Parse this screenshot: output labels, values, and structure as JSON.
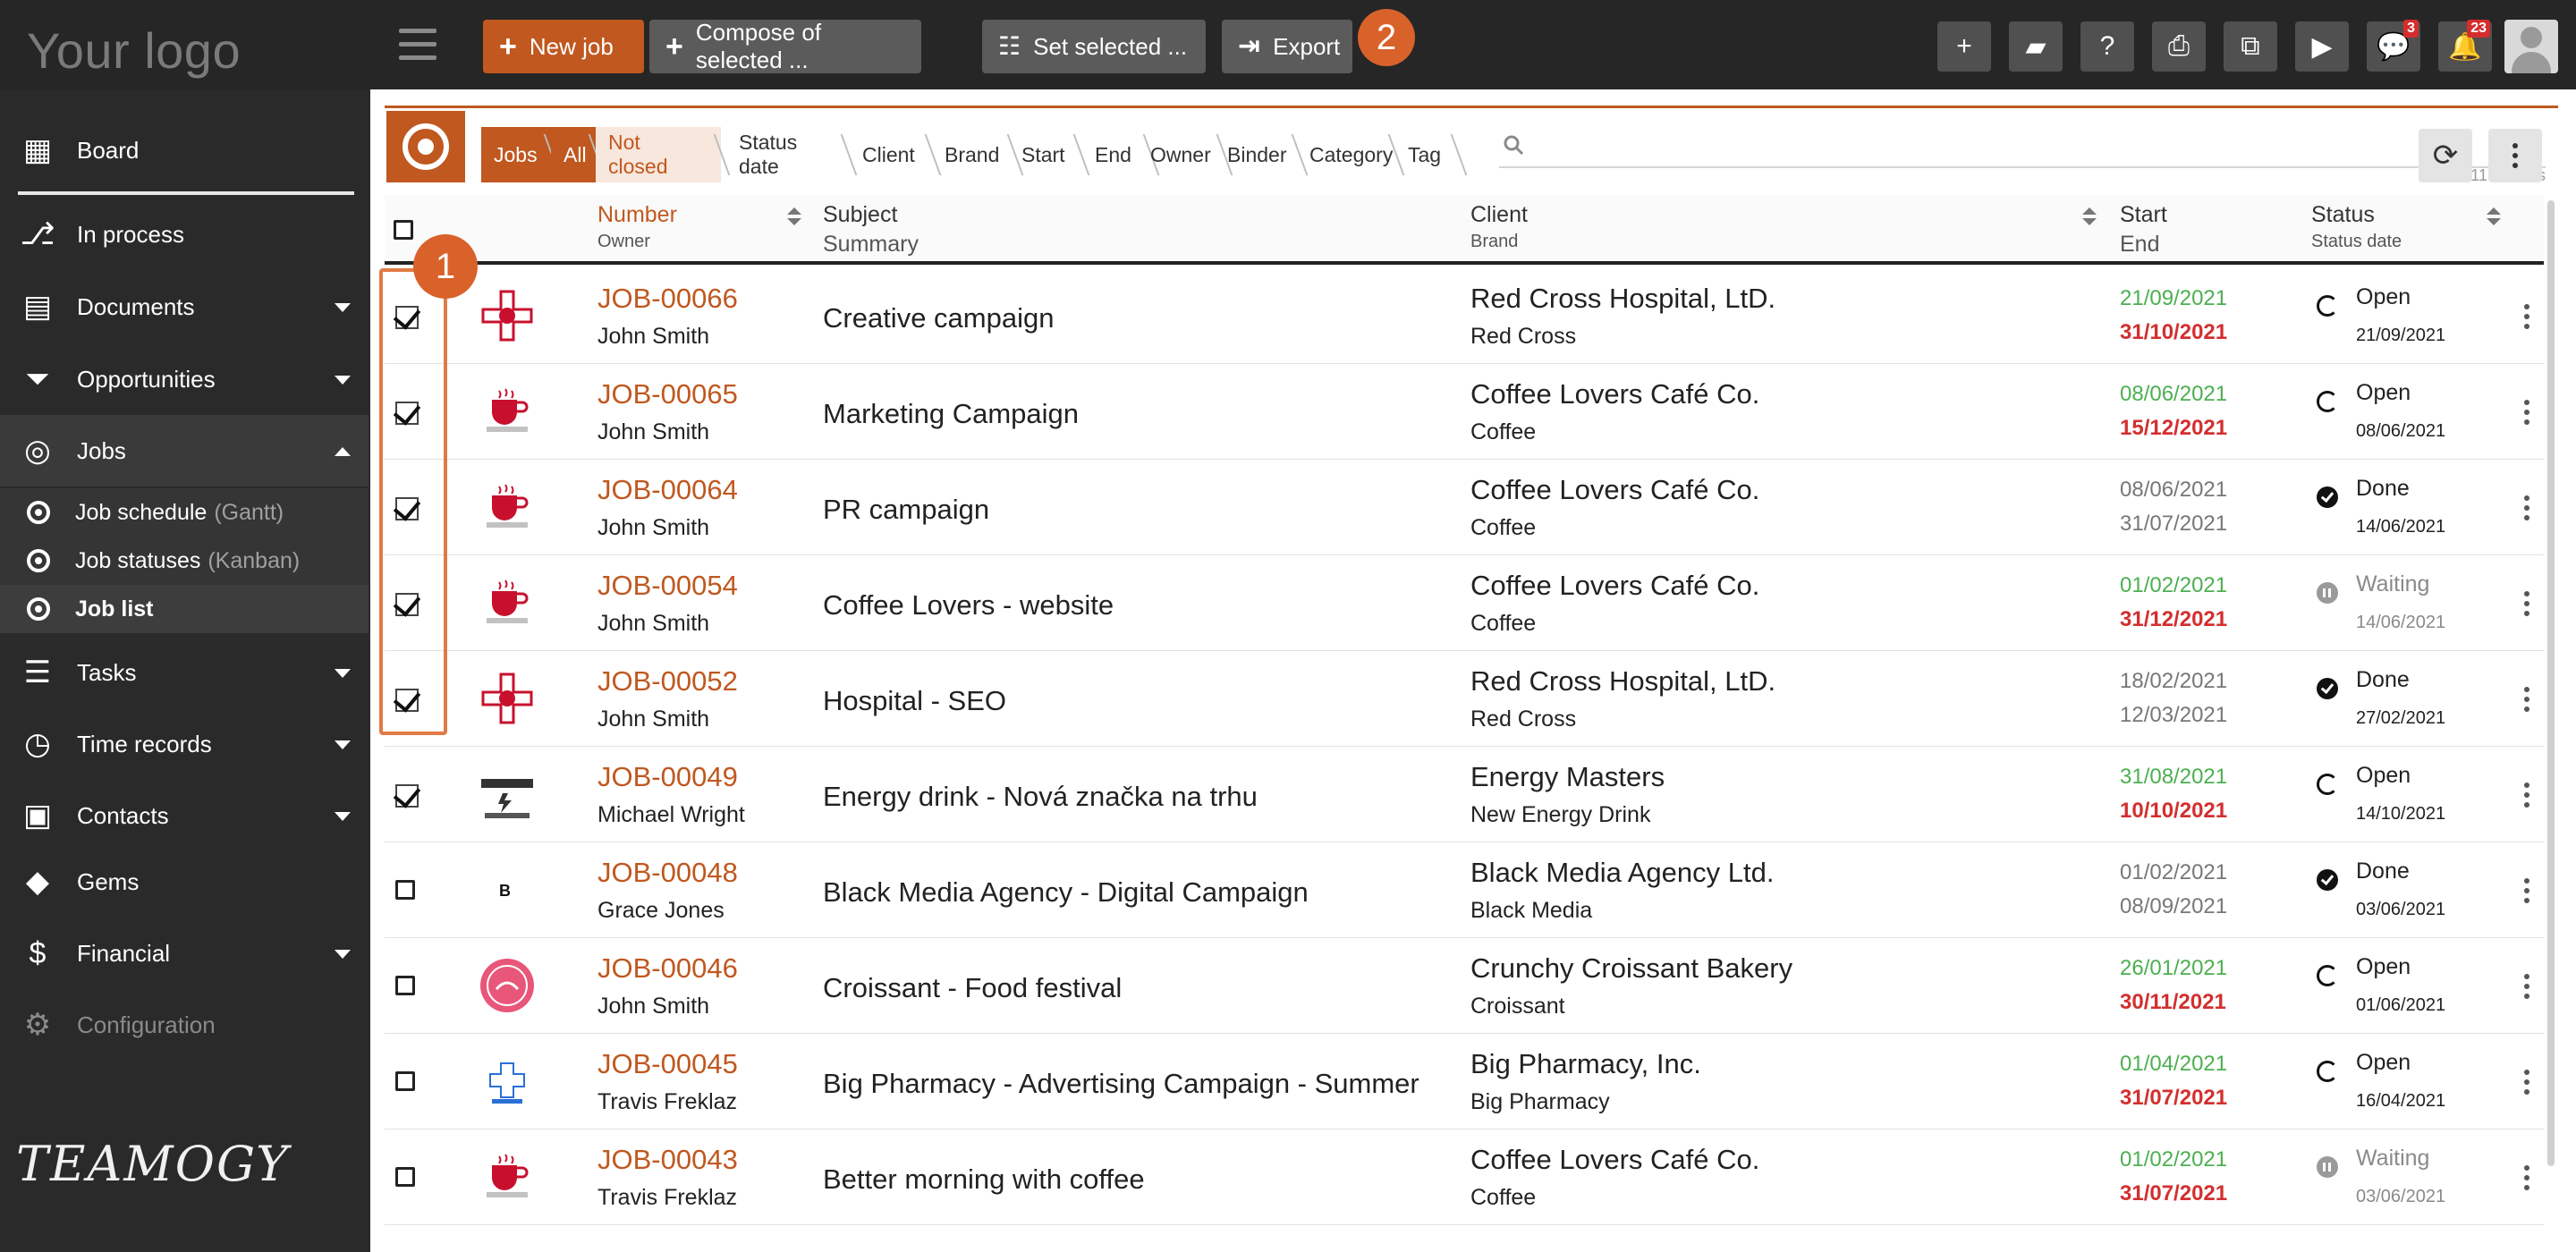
{
  "app": {
    "logo_text": "Your logo",
    "brand": "TEAMOGY"
  },
  "toolbar": {
    "new_job": "New job",
    "compose": "Compose of selected ...",
    "set_selected": "Set selected ...",
    "export": "Export",
    "callout_1": "1",
    "callout_2": "2",
    "chat_count": "3",
    "notif_count": "23"
  },
  "sidebar": {
    "items": [
      {
        "label": "Board",
        "icon": "grid-icon"
      },
      {
        "label": "In process",
        "icon": "flow-icon"
      },
      {
        "label": "Documents",
        "icon": "document-icon"
      },
      {
        "label": "Opportunities",
        "icon": "funnel-icon"
      },
      {
        "label": "Jobs",
        "icon": "target-icon"
      },
      {
        "label": "Tasks",
        "icon": "tasks-icon"
      },
      {
        "label": "Time records",
        "icon": "clock-icon"
      },
      {
        "label": "Contacts",
        "icon": "contact-icon"
      },
      {
        "label": "Gems",
        "icon": "gem-icon"
      },
      {
        "label": "Financial",
        "icon": "dollar-icon"
      },
      {
        "label": "Configuration",
        "icon": "gear-icon"
      }
    ],
    "jobs_sub": [
      {
        "label": "Job schedule",
        "muted": "(Gantt)"
      },
      {
        "label": "Job statuses",
        "muted": "(Kanban)"
      },
      {
        "label": "Job list",
        "muted": ""
      }
    ]
  },
  "filters": {
    "crumbs": [
      "Jobs",
      "All",
      "Not closed",
      "Status date",
      "Client",
      "Brand",
      "Start",
      "End",
      "Owner",
      "Binder",
      "Category",
      "Tag"
    ],
    "records": "11/11 records"
  },
  "table": {
    "headers": {
      "number": "Number",
      "owner": "Owner",
      "subject": "Subject",
      "summary": "Summary",
      "client": "Client",
      "brand": "Brand",
      "start": "Start",
      "end": "End",
      "status": "Status",
      "status_date": "Status date"
    },
    "rows": [
      {
        "no": "JOB-00066",
        "owner": "John Smith",
        "subject": "Creative campaign",
        "client": "Red Cross Hospital, LtD.",
        "brand": "Red Cross",
        "start": "21/09/2021",
        "end": "31/10/2021",
        "startc": "green",
        "endc": "red",
        "status": "Open",
        "sdate": "21/09/2021",
        "sicon": "open",
        "checked": true,
        "logo": "redcross"
      },
      {
        "no": "JOB-00065",
        "owner": "John Smith",
        "subject": "Marketing Campaign",
        "client": "Coffee Lovers Café Co.",
        "brand": "Coffee",
        "start": "08/06/2021",
        "end": "15/12/2021",
        "startc": "green",
        "endc": "red",
        "status": "Open",
        "sdate": "08/06/2021",
        "sicon": "open",
        "checked": true,
        "logo": "coffee"
      },
      {
        "no": "JOB-00064",
        "owner": "John Smith",
        "subject": "PR campaign",
        "client": "Coffee Lovers Café Co.",
        "brand": "Coffee",
        "start": "08/06/2021",
        "end": "31/07/2021",
        "startc": "gray",
        "endc": "gray",
        "status": "Done",
        "sdate": "14/06/2021",
        "sicon": "done",
        "checked": true,
        "logo": "coffee"
      },
      {
        "no": "JOB-00054",
        "owner": "John Smith",
        "subject": "Coffee Lovers - website",
        "client": "Coffee Lovers Café Co.",
        "brand": "Coffee",
        "start": "01/02/2021",
        "end": "31/12/2021",
        "startc": "green",
        "endc": "red",
        "status": "Waiting",
        "sdate": "14/06/2021",
        "sicon": "wait",
        "checked": true,
        "logo": "coffee"
      },
      {
        "no": "JOB-00052",
        "owner": "John Smith",
        "subject": "Hospital - SEO",
        "client": "Red Cross Hospital, LtD.",
        "brand": "Red Cross",
        "start": "18/02/2021",
        "end": "12/03/2021",
        "startc": "gray",
        "endc": "gray",
        "status": "Done",
        "sdate": "27/02/2021",
        "sicon": "done",
        "checked": true,
        "logo": "redcross"
      },
      {
        "no": "JOB-00049",
        "owner": "Michael Wright",
        "subject": "Energy drink - Nová značka na trhu",
        "client": "Energy Masters",
        "brand": "New Energy Drink",
        "start": "31/08/2021",
        "end": "10/10/2021",
        "startc": "green",
        "endc": "red",
        "status": "Open",
        "sdate": "14/10/2021",
        "sicon": "open",
        "checked": true,
        "logo": "energy"
      },
      {
        "no": "JOB-00048",
        "owner": "Grace Jones",
        "subject": "Black Media Agency - Digital Campaign",
        "client": "Black Media Agency Ltd.",
        "brand": "Black Media",
        "start": "01/02/2021",
        "end": "08/09/2021",
        "startc": "gray",
        "endc": "gray",
        "status": "Done",
        "sdate": "03/06/2021",
        "sicon": "done",
        "checked": false,
        "logo": "black"
      },
      {
        "no": "JOB-00046",
        "owner": "John Smith",
        "subject": "Croissant - Food festival",
        "client": "Crunchy Croissant Bakery",
        "brand": "Croissant",
        "start": "26/01/2021",
        "end": "30/11/2021",
        "startc": "green",
        "endc": "red",
        "status": "Open",
        "sdate": "01/06/2021",
        "sicon": "open",
        "checked": false,
        "logo": "croissant"
      },
      {
        "no": "JOB-00045",
        "owner": "Travis Freklaz",
        "subject": "Big Pharmacy - Advertising Campaign - Summer",
        "client": "Big Pharmacy, Inc.",
        "brand": "Big Pharmacy",
        "start": "01/04/2021",
        "end": "31/07/2021",
        "startc": "green",
        "endc": "red",
        "status": "Open",
        "sdate": "16/04/2021",
        "sicon": "open",
        "checked": false,
        "logo": "pharmacy"
      },
      {
        "no": "JOB-00043",
        "owner": "Travis Freklaz",
        "subject": "Better morning with coffee",
        "client": "Coffee Lovers Café Co.",
        "brand": "Coffee",
        "start": "01/02/2021",
        "end": "31/07/2021",
        "startc": "green",
        "endc": "red",
        "status": "Waiting",
        "sdate": "03/06/2021",
        "sicon": "wait",
        "checked": false,
        "logo": "coffee"
      }
    ]
  },
  "colors": {
    "accent": "#c0581f",
    "sidebar": "#2a2a2a",
    "topbar": "#262626",
    "green": "#4caf50",
    "red": "#d32f2f"
  }
}
